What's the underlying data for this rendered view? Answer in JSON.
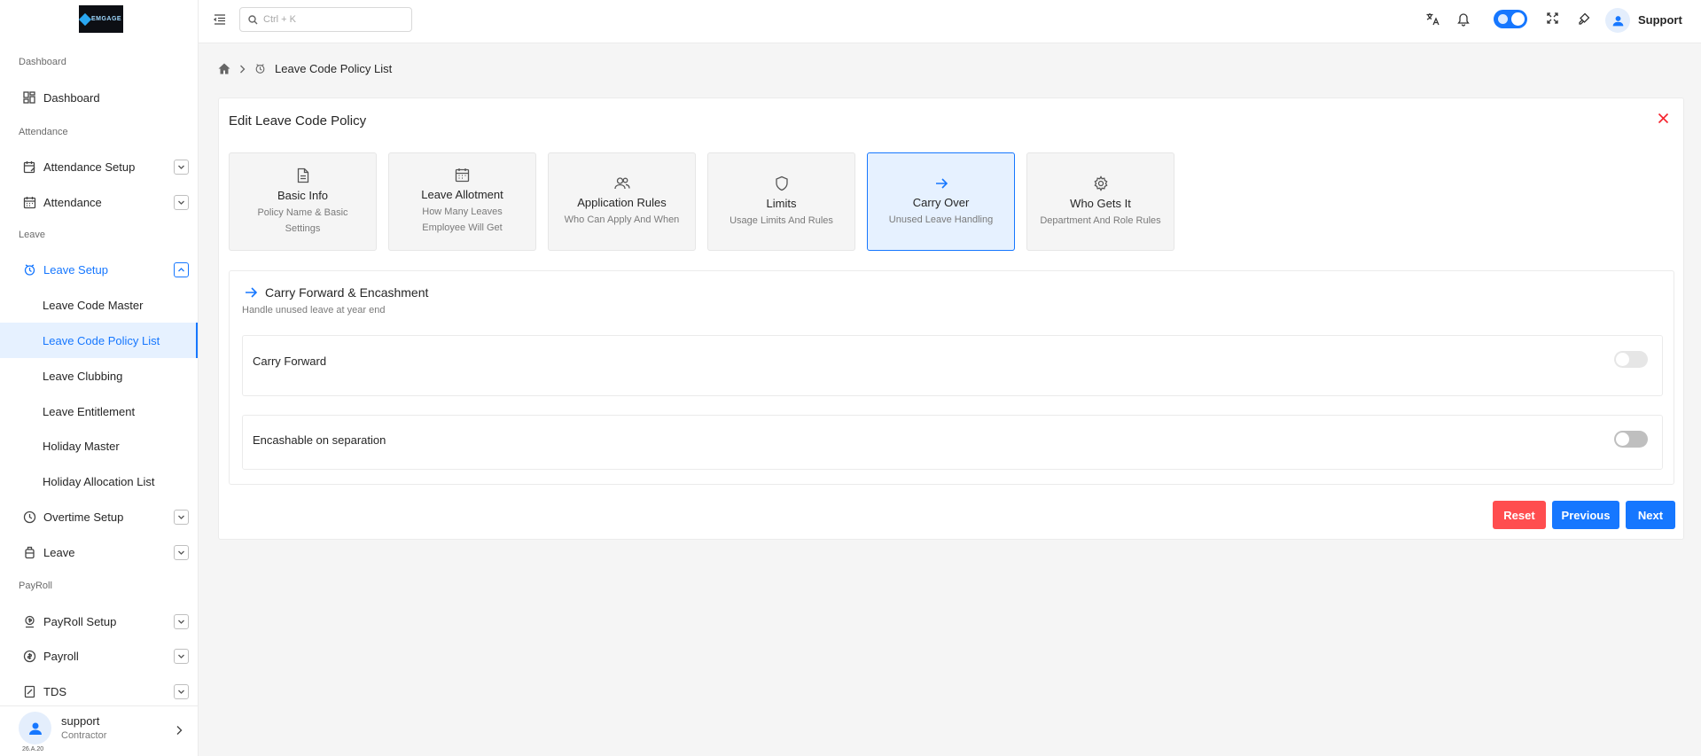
{
  "logo": {
    "text": "EMGAGE"
  },
  "search": {
    "placeholder": "Ctrl + K"
  },
  "user": {
    "name": "Support",
    "card_name": "support",
    "role": "Contractor",
    "version": "26.A.20"
  },
  "sidebar": {
    "sections": {
      "dashboard": "Dashboard",
      "attendance": "Attendance",
      "leave": "Leave",
      "payroll": "PayRoll"
    },
    "items": {
      "dashboard": "Dashboard",
      "attendance_setup": "Attendance Setup",
      "attendance": "Attendance",
      "leave_setup": "Leave Setup",
      "overtime_setup": "Overtime Setup",
      "leave": "Leave",
      "payroll_setup": "PayRoll Setup",
      "payroll": "Payroll",
      "tds": "TDS"
    },
    "leave_setup_sub": [
      "Leave Code Master",
      "Leave Code Policy List",
      "Leave Clubbing",
      "Leave Entitlement",
      "Holiday Master",
      "Holiday Allocation List"
    ]
  },
  "breadcrumb": {
    "current": "Leave Code Policy List"
  },
  "page": {
    "title": "Edit Leave Code Policy"
  },
  "steps": [
    {
      "title": "Basic Info",
      "desc": "Policy Name & Basic Settings",
      "icon": "file-icon"
    },
    {
      "title": "Leave Allotment",
      "desc": "How Many Leaves Employee Will Get",
      "icon": "calendar-icon"
    },
    {
      "title": "Application Rules",
      "desc": "Who Can Apply And When",
      "icon": "users-icon"
    },
    {
      "title": "Limits",
      "desc": "Usage Limits And Rules",
      "icon": "shield-icon"
    },
    {
      "title": "Carry Over",
      "desc": "Unused Leave Handling",
      "icon": "arrow-right-icon",
      "active": true
    },
    {
      "title": "Who Gets It",
      "desc": "Department And Role Rules",
      "icon": "gear-icon"
    }
  ],
  "section": {
    "title": "Carry Forward & Encashment",
    "subtitle": "Handle unused leave at year end",
    "fields": [
      {
        "label": "Carry Forward",
        "enabled": false,
        "disabled": true
      },
      {
        "label": "Encashable on separation",
        "enabled": false,
        "disabled": false
      }
    ]
  },
  "buttons": {
    "reset": "Reset",
    "previous": "Previous",
    "next": "Next"
  },
  "colors": {
    "primary": "#1677ff",
    "danger": "#ff4d4f",
    "active_bg": "#e6f1ff"
  }
}
